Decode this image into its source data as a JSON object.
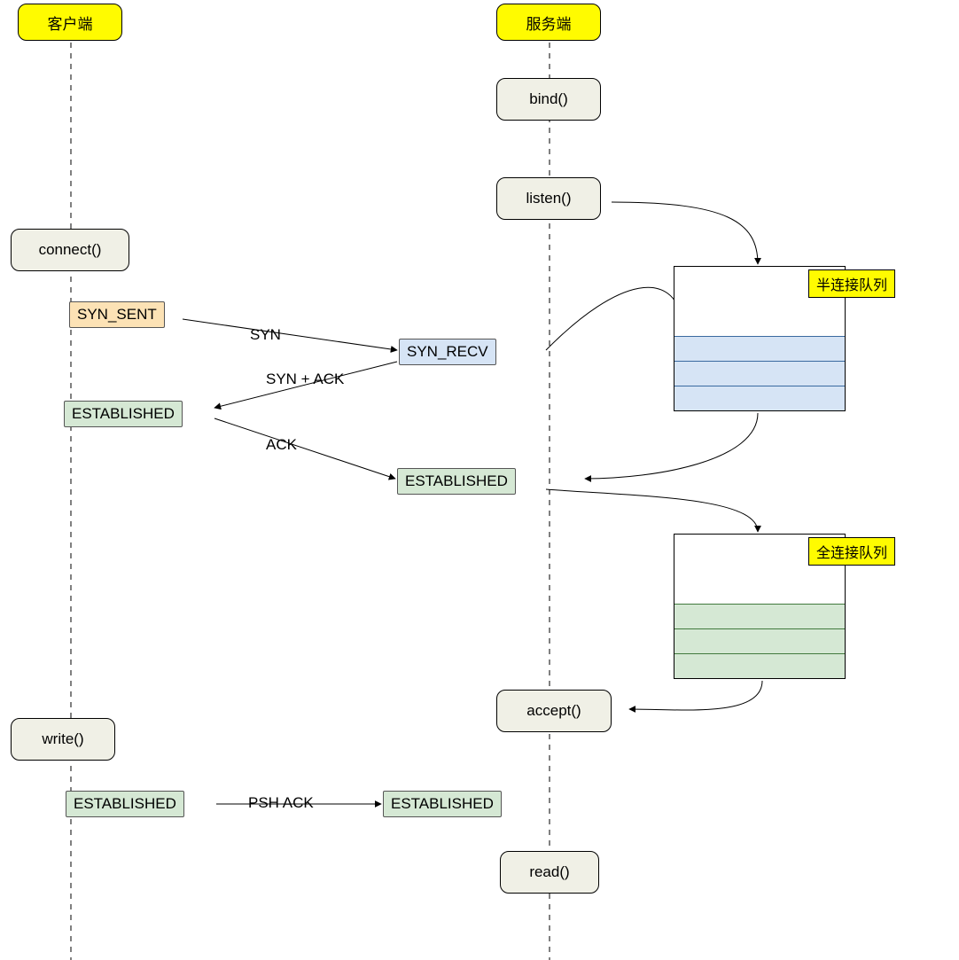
{
  "actors": {
    "client": "客户端",
    "server": "服务端"
  },
  "client_calls": {
    "connect": "connect()",
    "write": "write()"
  },
  "server_calls": {
    "bind": "bind()",
    "listen": "listen()",
    "accept": "accept()",
    "read": "read()"
  },
  "states": {
    "syn_sent": "SYN_SENT",
    "syn_recv": "SYN_RECV",
    "established": "ESTABLISHED"
  },
  "messages": {
    "syn": "SYN",
    "syn_ack": "SYN + ACK",
    "ack": "ACK",
    "psh_ack": "PSH ACK"
  },
  "queues": {
    "half": "半连接队列",
    "full": "全连接队列"
  },
  "colors": {
    "actor_bg": "#fffb00",
    "call_bg": "#f0f0e6",
    "syn_sent_bg": "#fce2b5",
    "syn_recv_bg": "#d6e4f5",
    "established_bg": "#d5e8d4"
  }
}
